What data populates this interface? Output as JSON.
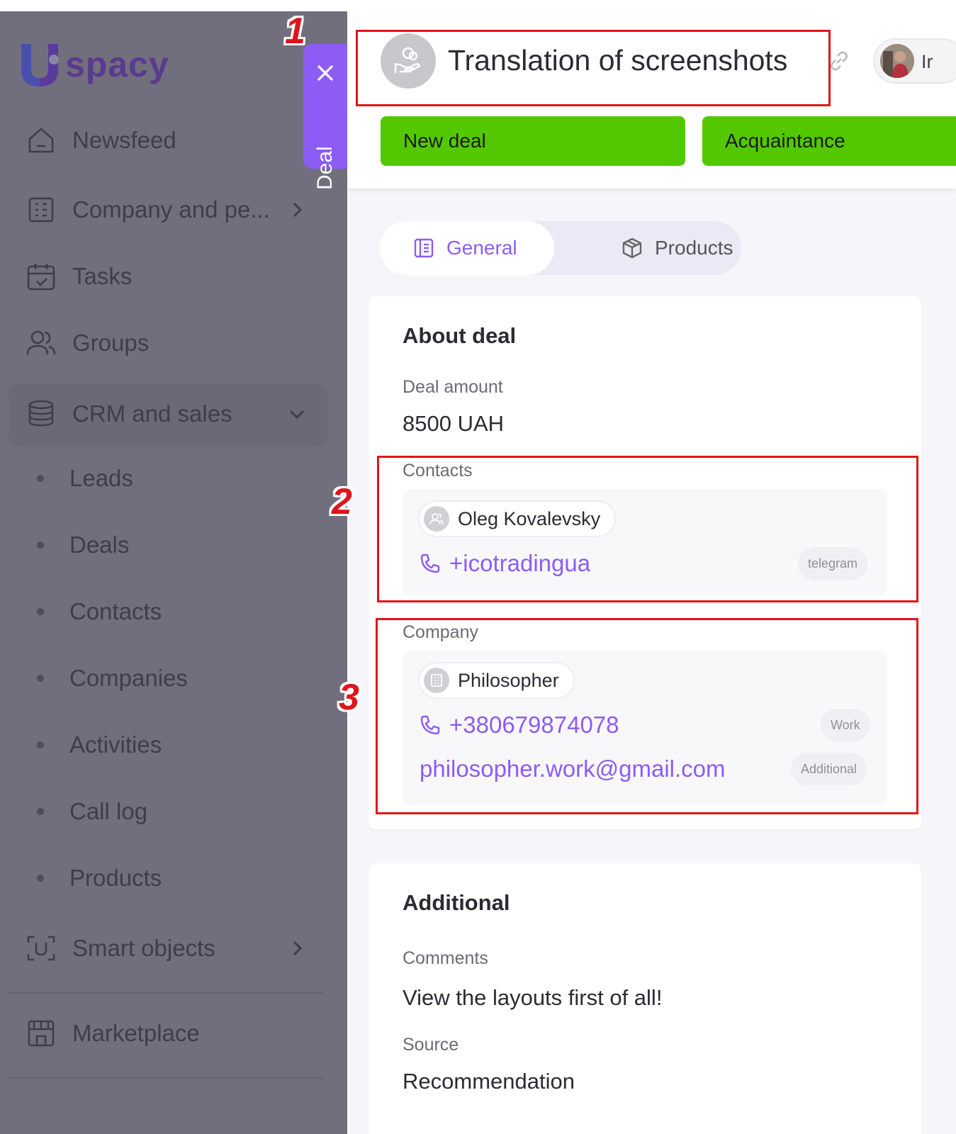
{
  "app": {
    "logo_text": "spacy"
  },
  "sidebar": {
    "items": [
      {
        "label": "Newsfeed",
        "icon": "home-icon"
      },
      {
        "label": "Company and pe...",
        "icon": "building-icon"
      },
      {
        "label": "Tasks",
        "icon": "calendar-check-icon"
      },
      {
        "label": "Groups",
        "icon": "people-icon"
      },
      {
        "label": "CRM and sales",
        "icon": "database-icon"
      },
      {
        "label": "Smart objects",
        "icon": "scan-icon"
      },
      {
        "label": "Marketplace",
        "icon": "store-icon"
      }
    ],
    "crm_sub": [
      "Leads",
      "Deals",
      "Contacts",
      "Companies",
      "Activities",
      "Call log",
      "Products"
    ]
  },
  "deal_tab": {
    "label": "Deal"
  },
  "header": {
    "title": "Translation of screenshots",
    "user_name": "Ir",
    "stages": [
      "New deal",
      "Acquaintance"
    ],
    "stage_color": "#53c801"
  },
  "tabs": {
    "general": "General",
    "products": "Products",
    "accent": "#8d5cf5"
  },
  "about": {
    "title": "About deal",
    "amount_label": "Deal amount",
    "amount_value": "8500 UAH",
    "contacts_label": "Contacts",
    "contact_name": "Oleg Kovalevsky",
    "contact_phone": "+icotradingua",
    "contact_phone_tag": "telegram",
    "company_label": "Company",
    "company_name": "Philosopher",
    "company_phone": "+380679874078",
    "company_phone_tag": "Work",
    "company_email": "philosopher.work@gmail.com",
    "company_email_tag": "Additional"
  },
  "additional": {
    "title": "Additional",
    "comments_label": "Comments",
    "comments_value": "View the layouts first of all!",
    "source_label": "Source",
    "source_value": "Recommendation"
  },
  "annotations": [
    "1",
    "2",
    "3"
  ]
}
